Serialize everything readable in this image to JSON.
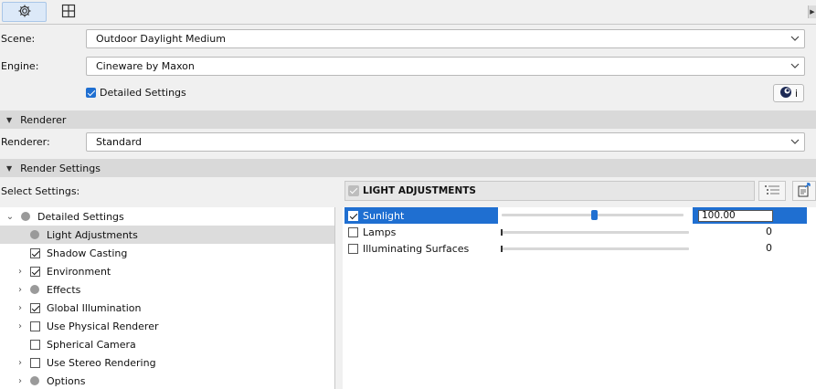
{
  "toolbar": {
    "buttons": [
      {
        "name": "settings",
        "icon": "gear-icon",
        "active": true
      },
      {
        "name": "grid",
        "icon": "grid-view-icon",
        "active": false
      }
    ]
  },
  "scene": {
    "label": "Scene:",
    "value": "Outdoor Daylight Medium"
  },
  "engine": {
    "label": "Engine:",
    "value": "Cineware by Maxon"
  },
  "detailed_settings": {
    "label": "Detailed Settings",
    "checked": true
  },
  "info_button": {
    "icon": "cinema4d-icon",
    "text": "i"
  },
  "renderer_section": {
    "title": "Renderer"
  },
  "renderer": {
    "label": "Renderer:",
    "value": "Standard"
  },
  "render_settings_section": {
    "title": "Render Settings"
  },
  "select_settings_label": "Select Settings:",
  "tree": [
    {
      "label": "Detailed Settings",
      "icon": "dot",
      "expanded": true,
      "level": 0
    },
    {
      "label": "Light Adjustments",
      "icon": "dot",
      "level": 1,
      "selected": true
    },
    {
      "label": "Shadow Casting",
      "icon": "checkbox-checked",
      "level": 1
    },
    {
      "label": "Environment",
      "icon": "checkbox-checked",
      "level": 1,
      "has_children": true
    },
    {
      "label": "Effects",
      "icon": "dot",
      "level": 1,
      "has_children": true
    },
    {
      "label": "Global Illumination",
      "icon": "checkbox-checked",
      "level": 1,
      "has_children": true
    },
    {
      "label": "Use Physical Renderer",
      "icon": "checkbox-unchecked",
      "level": 1,
      "has_children": true
    },
    {
      "label": "Spherical Camera",
      "icon": "checkbox-unchecked",
      "level": 1
    },
    {
      "label": "Use Stereo Rendering",
      "icon": "checkbox-unchecked",
      "level": 1,
      "has_children": true
    },
    {
      "label": "Options",
      "icon": "dot",
      "level": 1,
      "has_children": true
    }
  ],
  "light_panel": {
    "title": "LIGHT ADJUSTMENTS",
    "rows": [
      {
        "label": "Sunlight",
        "checked": true,
        "selected": true,
        "value": "100.00",
        "level": 0.5
      },
      {
        "label": "Lamps",
        "checked": false,
        "selected": false,
        "value": "0",
        "level": 0
      },
      {
        "label": "Illuminating Surfaces",
        "checked": false,
        "selected": false,
        "value": "0",
        "level": 0
      }
    ]
  },
  "colors": {
    "accent": "#1f6fd1",
    "section_bar": "#d9d9d9",
    "background": "#f0f0f0"
  }
}
